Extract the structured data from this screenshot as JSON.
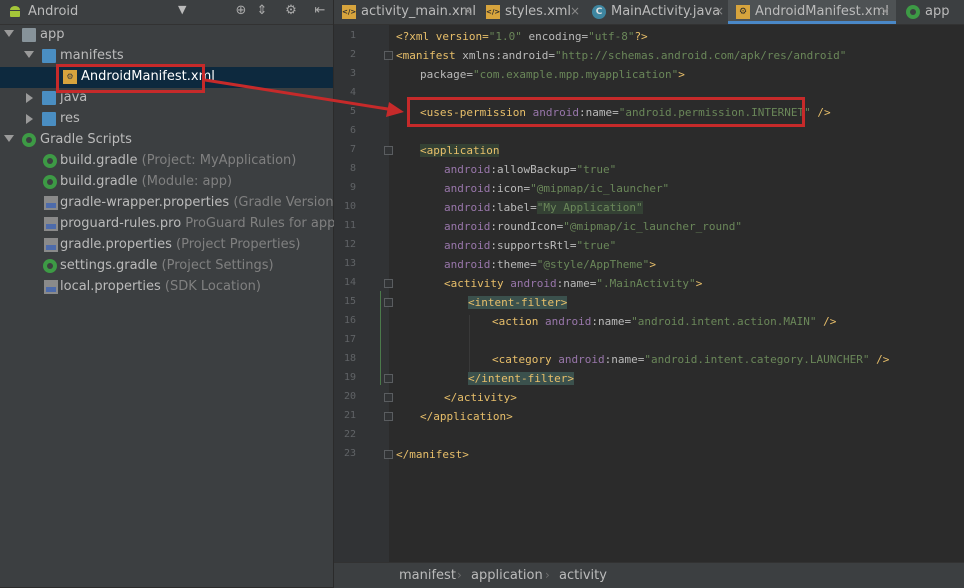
{
  "project_panel": {
    "view_mode": "Android",
    "tree": [
      {
        "label": "app",
        "hint": ""
      },
      {
        "label": "manifests",
        "hint": ""
      },
      {
        "label": "AndroidManifest.xml",
        "hint": ""
      },
      {
        "label": "java",
        "hint": ""
      },
      {
        "label": "res",
        "hint": ""
      },
      {
        "label": "Gradle Scripts",
        "hint": ""
      },
      {
        "label": "build.gradle",
        "hint": "(Project: MyApplication)"
      },
      {
        "label": "build.gradle",
        "hint": "(Module: app)"
      },
      {
        "label": "gradle-wrapper.properties",
        "hint": "(Gradle Version)"
      },
      {
        "label": "proguard-rules.pro",
        "hint": "ProGuard Rules for app)"
      },
      {
        "label": "gradle.properties",
        "hint": "(Project Properties)"
      },
      {
        "label": "settings.gradle",
        "hint": "(Project Settings)"
      },
      {
        "label": "local.properties",
        "hint": "(SDK Location)"
      }
    ]
  },
  "tabs": [
    {
      "label": "activity_main.xml",
      "icon": "xml-file-icon"
    },
    {
      "label": "styles.xml",
      "icon": "xml-file-icon"
    },
    {
      "label": "MainActivity.java",
      "icon": "java-class-icon"
    },
    {
      "label": "AndroidManifest.xml",
      "icon": "manifest-file-icon",
      "active": true
    },
    {
      "label": "app",
      "icon": "gradle-icon"
    }
  ],
  "tab_icon_letters": {
    "java": "C",
    "xml": "</>"
  },
  "tab_close_glyph": "×",
  "editor": {
    "line_numbers": [
      "1",
      "2",
      "3",
      "4",
      "5",
      "6",
      "7",
      "8",
      "9",
      "10",
      "11",
      "12",
      "13",
      "14",
      "15",
      "16",
      "17",
      "18",
      "19",
      "20",
      "21",
      "22",
      "23"
    ],
    "lines": {
      "l1": {
        "a": "<?xml version=",
        "b": "\"1.0\"",
        "c": " encoding=",
        "d": "\"utf-8\"",
        "e": "?>"
      },
      "l2": {
        "a": "<manifest ",
        "b": "xmlns:android=",
        "c": "\"http://schemas.android.com/apk/res/android\""
      },
      "l3": {
        "a": "package=",
        "b": "\"com.example.mpp.myapplication\"",
        "c": ">"
      },
      "l5": {
        "a": "<uses-permission ",
        "b": "android",
        "c": ":name=",
        "d": "\"android.permission.INTERNET\"",
        "e": " />"
      },
      "l7": {
        "a": "<application"
      },
      "l8": {
        "ns": "android",
        "at": ":allowBackup=",
        "v": "\"true\""
      },
      "l9": {
        "ns": "android",
        "at": ":icon=",
        "v": "\"@mipmap/ic_launcher\""
      },
      "l10": {
        "ns": "android",
        "at": ":label=",
        "v": "\"My Application\""
      },
      "l11": {
        "ns": "android",
        "at": ":roundIcon=",
        "v": "\"@mipmap/ic_launcher_round\""
      },
      "l12": {
        "ns": "android",
        "at": ":supportsRtl=",
        "v": "\"true\""
      },
      "l13": {
        "ns": "android",
        "at": ":theme=",
        "v": "\"@style/AppTheme\"",
        "end": ">"
      },
      "l14": {
        "a": "<activity ",
        "ns": "android",
        "at": ":name=",
        "v": "\".MainActivity\"",
        "end": ">"
      },
      "l15": {
        "a": "<intent-filter>"
      },
      "l16": {
        "a": "<action ",
        "ns": "android",
        "at": ":name=",
        "v": "\"android.intent.action.MAIN\"",
        "end": " />"
      },
      "l18": {
        "a": "<category ",
        "ns": "android",
        "at": ":name=",
        "v": "\"android.intent.category.LAUNCHER\"",
        "end": " />"
      },
      "l19": {
        "a": "</intent-filter>"
      },
      "l20": {
        "a": "</activity>"
      },
      "l21": {
        "a": "</application>"
      },
      "l23": {
        "a": "</manifest>"
      }
    }
  },
  "breadcrumb": [
    "manifest",
    "application",
    "activity"
  ],
  "breadcrumb_sep": "›",
  "colors": {
    "annotation": "#c62a2a",
    "selection": "#0d293e",
    "accent": "#4a88c7"
  }
}
